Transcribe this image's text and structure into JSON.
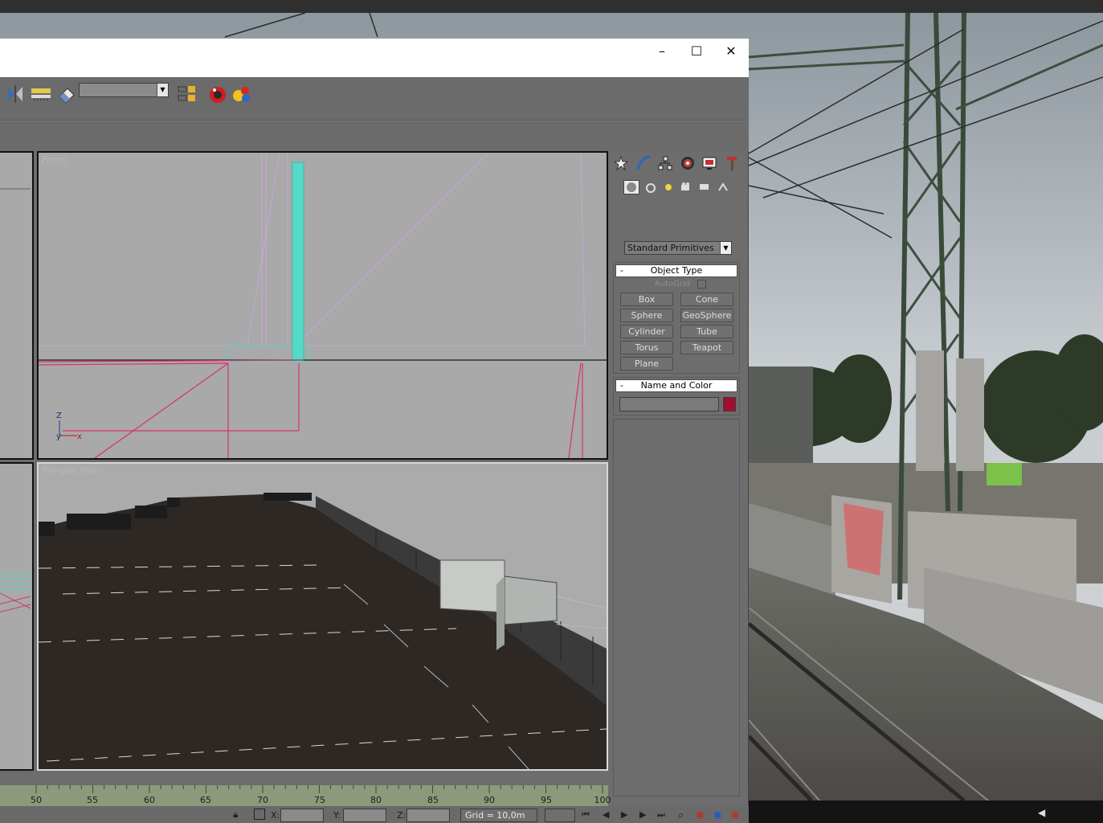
{
  "window": {
    "minimize_glyph": "–",
    "maximize_glyph": "☐",
    "close_glyph": "✕"
  },
  "toolbar": {
    "icons": [
      "mirror-icon",
      "align-icon",
      "eraser-icon",
      "layer-icon",
      "render-setup-icon",
      "material-editor-icon"
    ],
    "selection_set_value": ""
  },
  "viewports": {
    "front_label": "Front",
    "perspective_label": "Perspective",
    "axis_z": "Z",
    "axis_y": "y",
    "axis_x": "x"
  },
  "command_panel": {
    "tabs": [
      "create-tab",
      "modify-tab",
      "hierarchy-tab",
      "motion-tab",
      "display-tab",
      "utilities-tab"
    ],
    "category": "Standard Primitives",
    "object_type": {
      "title": "Object Type",
      "minus": "-",
      "autogrid": "AutoGrid",
      "buttons": [
        "Box",
        "Cone",
        "Sphere",
        "GeoSphere",
        "Cylinder",
        "Tube",
        "Torus",
        "Teapot",
        "Plane"
      ]
    },
    "name_and_color": {
      "title": "Name and Color",
      "minus": "-",
      "name_value": "",
      "color": "#a0102e"
    }
  },
  "timeline": {
    "ticks": [
      "50",
      "55",
      "60",
      "65",
      "70",
      "75",
      "80",
      "85",
      "90",
      "95",
      "100"
    ]
  },
  "status": {
    "x_label": "X:",
    "y_label": "Y:",
    "z_label": "Z:",
    "x_value": "",
    "y_value": "",
    "z_value": "",
    "grid": "Grid = 10,0m"
  },
  "colors": {
    "accent": "#a0102e",
    "viewport_bg": "#a9a9a9",
    "ui_bg": "#6d6d6d"
  }
}
